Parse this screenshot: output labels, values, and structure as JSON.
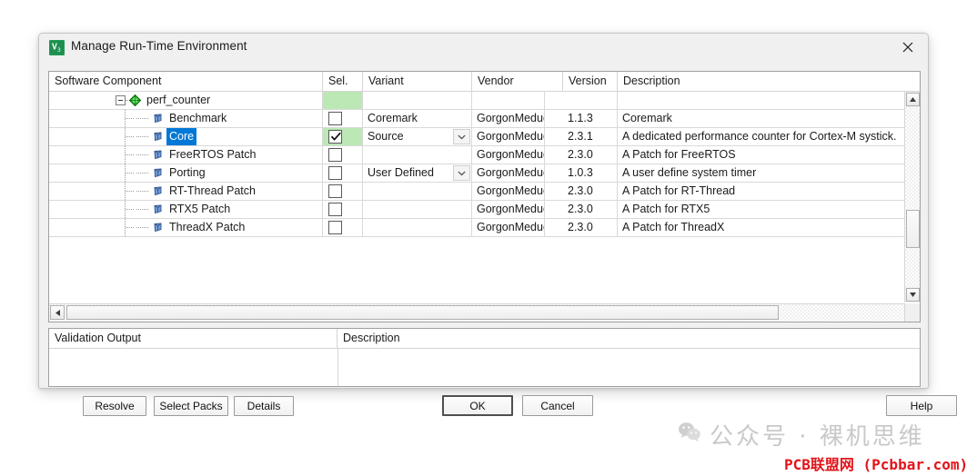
{
  "window": {
    "title": "Manage Run-Time Environment",
    "icon": "uvision-icon",
    "close_label": "×"
  },
  "components_table": {
    "columns": [
      "Software Component",
      "Sel.",
      "Variant",
      "Vendor",
      "Version",
      "Description"
    ],
    "rows": [
      {
        "level": 0,
        "icon": "green-diamond-icon",
        "expander": "collapse-box",
        "name": "perf_counter",
        "selected": false,
        "sel_green": true,
        "checkbox": null,
        "checked": false,
        "variant": "",
        "variant_dropdown": false,
        "vendor": "",
        "version": "",
        "description": ""
      },
      {
        "level": 1,
        "icon": "blue-diamond-icon",
        "expander": null,
        "name": "Benchmark",
        "selected": false,
        "sel_green": false,
        "checkbox": true,
        "checked": false,
        "variant": "Coremark",
        "variant_dropdown": false,
        "vendor": "GorgonMeducer",
        "version": "1.1.3",
        "description": "Coremark"
      },
      {
        "level": 1,
        "icon": "blue-diamond-icon",
        "expander": null,
        "name": "Core",
        "selected": true,
        "sel_green": true,
        "checkbox": true,
        "checked": true,
        "variant": "Source",
        "variant_dropdown": true,
        "vendor": "GorgonMeducer",
        "version": "2.3.1",
        "description": "A dedicated performance counter for Cortex-M systick."
      },
      {
        "level": 1,
        "icon": "blue-diamond-icon",
        "expander": null,
        "name": "FreeRTOS Patch",
        "selected": false,
        "sel_green": false,
        "checkbox": true,
        "checked": false,
        "variant": "",
        "variant_dropdown": false,
        "vendor": "GorgonMeducer",
        "version": "2.3.0",
        "description": "A Patch for FreeRTOS"
      },
      {
        "level": 1,
        "icon": "blue-diamond-icon",
        "expander": null,
        "name": "Porting",
        "selected": false,
        "sel_green": false,
        "checkbox": true,
        "checked": false,
        "variant": "User Defined",
        "variant_dropdown": true,
        "vendor": "GorgonMeducer",
        "version": "1.0.3",
        "description": "A user define system timer"
      },
      {
        "level": 1,
        "icon": "blue-diamond-icon",
        "expander": null,
        "name": "RT-Thread Patch",
        "selected": false,
        "sel_green": false,
        "checkbox": true,
        "checked": false,
        "variant": "",
        "variant_dropdown": false,
        "vendor": "GorgonMeducer",
        "version": "2.3.0",
        "description": "A Patch for RT-Thread"
      },
      {
        "level": 1,
        "icon": "blue-diamond-icon",
        "expander": null,
        "name": "RTX5 Patch",
        "selected": false,
        "sel_green": false,
        "checkbox": true,
        "checked": false,
        "variant": "",
        "variant_dropdown": false,
        "vendor": "GorgonMeducer",
        "version": "2.3.0",
        "description": "A Patch for RTX5"
      },
      {
        "level": 1,
        "icon": "blue-diamond-icon",
        "expander": null,
        "name": "ThreadX Patch",
        "selected": false,
        "sel_green": false,
        "checkbox": true,
        "checked": false,
        "variant": "",
        "variant_dropdown": false,
        "vendor": "GorgonMeducer",
        "version": "2.3.0",
        "description": "A Patch for ThreadX"
      }
    ]
  },
  "validation_panel": {
    "columns": [
      "Validation Output",
      "Description"
    ],
    "rows": []
  },
  "buttons": {
    "resolve": "Resolve",
    "select_packs": "Select Packs",
    "details": "Details",
    "ok": "OK",
    "cancel": "Cancel",
    "help": "Help"
  },
  "watermark": {
    "icon": "wechat-icon",
    "line1": "公众号 · 裸机思维",
    "line2": "PCB联盟网 (Pcbbar.com)"
  },
  "colors": {
    "selection_blue": "#0078d7",
    "sel_green": "#bbe8b4",
    "watermark_gray": "#c9c9c9",
    "watermark_red": "#e3131a",
    "dialog_bg": "#f0f0f0"
  }
}
